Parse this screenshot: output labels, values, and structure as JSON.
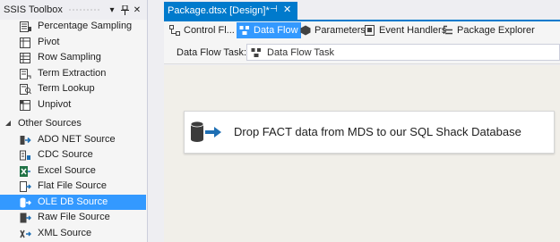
{
  "toolbox": {
    "title": "SSIS Toolbox",
    "header_buttons": {
      "dropdown": "▾",
      "pin": "📌",
      "close": "✕"
    },
    "items_top": [
      {
        "label": "Percentage Sampling",
        "icon": "percentage-sampling-icon"
      },
      {
        "label": "Pivot",
        "icon": "pivot-icon"
      },
      {
        "label": "Row Sampling",
        "icon": "row-sampling-icon"
      },
      {
        "label": "Term Extraction",
        "icon": "term-extraction-icon"
      },
      {
        "label": "Term Lookup",
        "icon": "term-lookup-icon"
      },
      {
        "label": "Unpivot",
        "icon": "unpivot-icon"
      }
    ],
    "group": {
      "label": "Other Sources",
      "expanded": true
    },
    "items_sources": [
      {
        "label": "ADO NET Source",
        "icon": "ado-net-source-icon"
      },
      {
        "label": "CDC Source",
        "icon": "cdc-source-icon"
      },
      {
        "label": "Excel Source",
        "icon": "excel-source-icon"
      },
      {
        "label": "Flat File Source",
        "icon": "flat-file-source-icon"
      },
      {
        "label": "OLE DB Source",
        "icon": "ole-db-source-icon",
        "selected": true
      },
      {
        "label": "Raw File Source",
        "icon": "raw-file-source-icon"
      },
      {
        "label": "XML Source",
        "icon": "xml-source-icon"
      }
    ]
  },
  "document": {
    "tab_title": "Package.dtsx [Design]*",
    "tab_pin": "⊣",
    "tab_close": "✕",
    "designer_tabs": [
      {
        "label": "Control Fl...",
        "icon": "control-flow-icon",
        "active": false
      },
      {
        "label": "Data Flow",
        "icon": "data-flow-icon",
        "active": true
      },
      {
        "label": "Parameters",
        "icon": "parameters-icon",
        "active": false
      },
      {
        "label": "Event Handlers",
        "icon": "event-handlers-icon",
        "active": false
      },
      {
        "label": "Package Explorer",
        "icon": "package-explorer-icon",
        "active": false
      }
    ],
    "task_label": "Data Flow Task:",
    "task_value": "Data Flow Task",
    "canvas_task_text": "Drop FACT data from MDS to our SQL Shack Database"
  },
  "colors": {
    "accent": "#007acc",
    "selection": "#3399ff",
    "canvas": "#f1efe9",
    "panel": "#f5f5f5"
  }
}
